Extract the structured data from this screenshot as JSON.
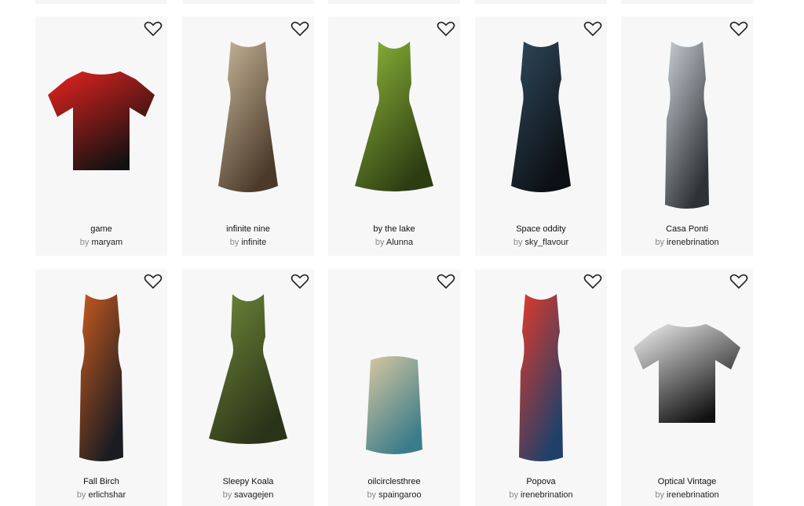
{
  "items": [
    {
      "title": "game",
      "by": "by",
      "author": "maryam",
      "garment": "tshirt",
      "colors": [
        "#e8231f",
        "#111111"
      ]
    },
    {
      "title": "infinite nine",
      "by": "by",
      "author": "infinite",
      "garment": "dress",
      "colors": [
        "#c8b89a",
        "#4b3a2a"
      ]
    },
    {
      "title": "by the lake",
      "by": "by",
      "author": "Alunna",
      "garment": "flare-dress",
      "colors": [
        "#8fb93a",
        "#2d3d12"
      ]
    },
    {
      "title": "Space oddity",
      "by": "by",
      "author": "sky_flavour",
      "garment": "dress",
      "colors": [
        "#2f4a5c",
        "#0c0f14"
      ]
    },
    {
      "title": "Casa Ponti",
      "by": "by",
      "author": "irenebrination",
      "garment": "sheath-dress",
      "colors": [
        "#c8cfd4",
        "#2e3236"
      ]
    },
    {
      "title": "Fall Birch",
      "by": "by",
      "author": "erlichshar",
      "garment": "sheath-dress",
      "colors": [
        "#c85a1e",
        "#1a1c22"
      ]
    },
    {
      "title": "Sleepy Koala",
      "by": "by",
      "author": "savagejen",
      "garment": "flare-dress",
      "colors": [
        "#6f8a3a",
        "#2a3218"
      ]
    },
    {
      "title": "oilcirclesthree",
      "by": "by",
      "author": "spaingaroo",
      "garment": "skirt",
      "colors": [
        "#d9c8a0",
        "#3a7c8a"
      ]
    },
    {
      "title": "Popova",
      "by": "by",
      "author": "irenebrination",
      "garment": "sheath-dress",
      "colors": [
        "#e23a2a",
        "#20406a"
      ]
    },
    {
      "title": "Optical Vintage",
      "by": "by",
      "author": "irenebrination",
      "garment": "tshirt",
      "colors": [
        "#f2f2f2",
        "#111111"
      ]
    }
  ],
  "icons": {
    "favorite": "heart-outline-icon"
  }
}
